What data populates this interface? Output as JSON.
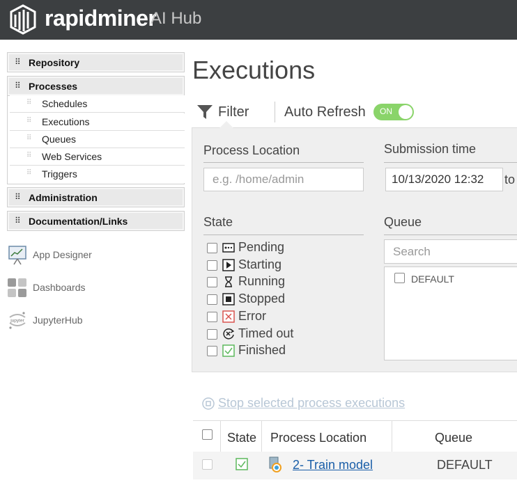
{
  "header": {
    "brand": "rapidminer",
    "subtitle": "AI Hub"
  },
  "sidebar": {
    "sections": [
      {
        "label": "Repository"
      },
      {
        "label": "Processes"
      },
      {
        "label": "Administration"
      },
      {
        "label": "Documentation/Links"
      }
    ],
    "process_items": [
      {
        "label": "Schedules"
      },
      {
        "label": "Executions"
      },
      {
        "label": "Queues"
      },
      {
        "label": "Web Services"
      },
      {
        "label": "Triggers"
      }
    ],
    "apps": [
      {
        "label": "App Designer",
        "icon": "app-designer-icon"
      },
      {
        "label": "Dashboards",
        "icon": "dashboards-icon"
      },
      {
        "label": "JupyterHub",
        "icon": "jupyter-icon"
      }
    ]
  },
  "main": {
    "title": "Executions",
    "filter_label": "Filter",
    "auto_refresh_label": "Auto Refresh",
    "auto_refresh_state": "ON",
    "filter": {
      "process_location_label": "Process Location",
      "process_location_placeholder": "e.g. /home/admin",
      "submission_time_label": "Submission time",
      "submission_time_value": "10/13/2020 12:32",
      "to_label": "to",
      "state_label": "State",
      "states": [
        {
          "label": "Pending",
          "icon": "pending-icon"
        },
        {
          "label": "Starting",
          "icon": "play-icon"
        },
        {
          "label": "Running",
          "icon": "hourglass-icon"
        },
        {
          "label": "Stopped",
          "icon": "stop-icon"
        },
        {
          "label": "Error",
          "icon": "error-icon"
        },
        {
          "label": "Timed out",
          "icon": "timeout-icon"
        },
        {
          "label": "Finished",
          "icon": "check-icon"
        }
      ],
      "queue_label": "Queue",
      "queue_search_placeholder": "Search",
      "queues": [
        {
          "label": "DEFAULT"
        }
      ]
    },
    "stop_link": "Stop selected process executions",
    "table": {
      "columns": [
        "State",
        "Process Location",
        "Queue"
      ],
      "rows": [
        {
          "state_icon": "check-icon",
          "location": "2- Train model",
          "queue": "DEFAULT"
        }
      ]
    }
  },
  "colors": {
    "header_bg": "#3c3f41",
    "toggle_on": "#8ad46a",
    "link": "#1a5ea8",
    "error": "#d9534f",
    "finished": "#5cb85c"
  }
}
